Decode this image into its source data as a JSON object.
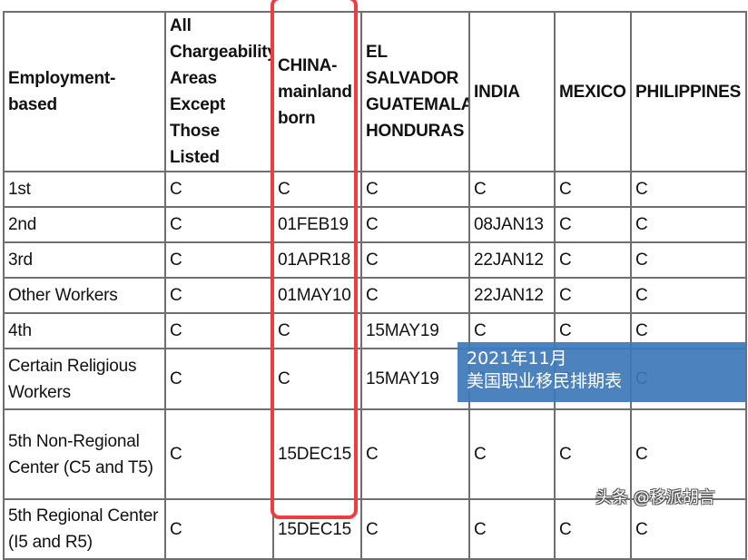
{
  "table": {
    "headers": [
      "Employment-\nbased",
      "All Chargeability Areas Except Those Listed",
      "CHINA-mainland born",
      "EL SALVADOR GUATEMALA HONDURAS",
      "INDIA",
      "MEXICO",
      "PHILIPPINES"
    ],
    "header_lines": {
      "h0": [
        "Employment-",
        "based"
      ],
      "h1": [
        "All",
        "Chargeability",
        "Areas Except",
        "Those Listed"
      ],
      "h2": [
        "CHINA-",
        "mainland",
        "born"
      ],
      "h3": [
        "EL",
        "SALVADOR",
        "GUATEMALA",
        "HONDURAS"
      ],
      "h4": [
        "INDIA"
      ],
      "h5": [
        "MEXICO"
      ],
      "h6": [
        "PHILIPPINES"
      ]
    },
    "rows": [
      {
        "category": "1st",
        "cells": [
          "C",
          "C",
          "C",
          "C",
          "C",
          "C"
        ]
      },
      {
        "category": "2nd",
        "cells": [
          "C",
          "01FEB19",
          "C",
          "08JAN13",
          "C",
          "C"
        ]
      },
      {
        "category": "3rd",
        "cells": [
          "C",
          "01APR18",
          "C",
          "22JAN12",
          "C",
          "C"
        ]
      },
      {
        "category": "Other Workers",
        "cells": [
          "C",
          "01MAY10",
          "C",
          "22JAN12",
          "C",
          "C"
        ]
      },
      {
        "category": "4th",
        "cells": [
          "C",
          "C",
          "15MAY19",
          "C",
          "C",
          "C"
        ]
      },
      {
        "category": "Certain Religious Workers",
        "cells": [
          "C",
          "C",
          "15MAY19",
          "C",
          "C",
          "C"
        ]
      },
      {
        "category": "5th Non-Regional Center (C5 and T5)",
        "cells": [
          "C",
          "15DEC15",
          "C",
          "C",
          "C",
          "C"
        ]
      },
      {
        "category": "5th Regional Center (I5 and R5)",
        "cells": [
          "C",
          "15DEC15",
          "C",
          "C",
          "C",
          "C"
        ]
      }
    ]
  },
  "highlight": {
    "column": "CHINA-mainland born",
    "color": "#ef3c40"
  },
  "banner": {
    "line1": "2021年11月",
    "line2": "美国职业移民排期表",
    "color": "#3d78ba"
  },
  "watermark": {
    "text": "头条 @移派胡言"
  }
}
